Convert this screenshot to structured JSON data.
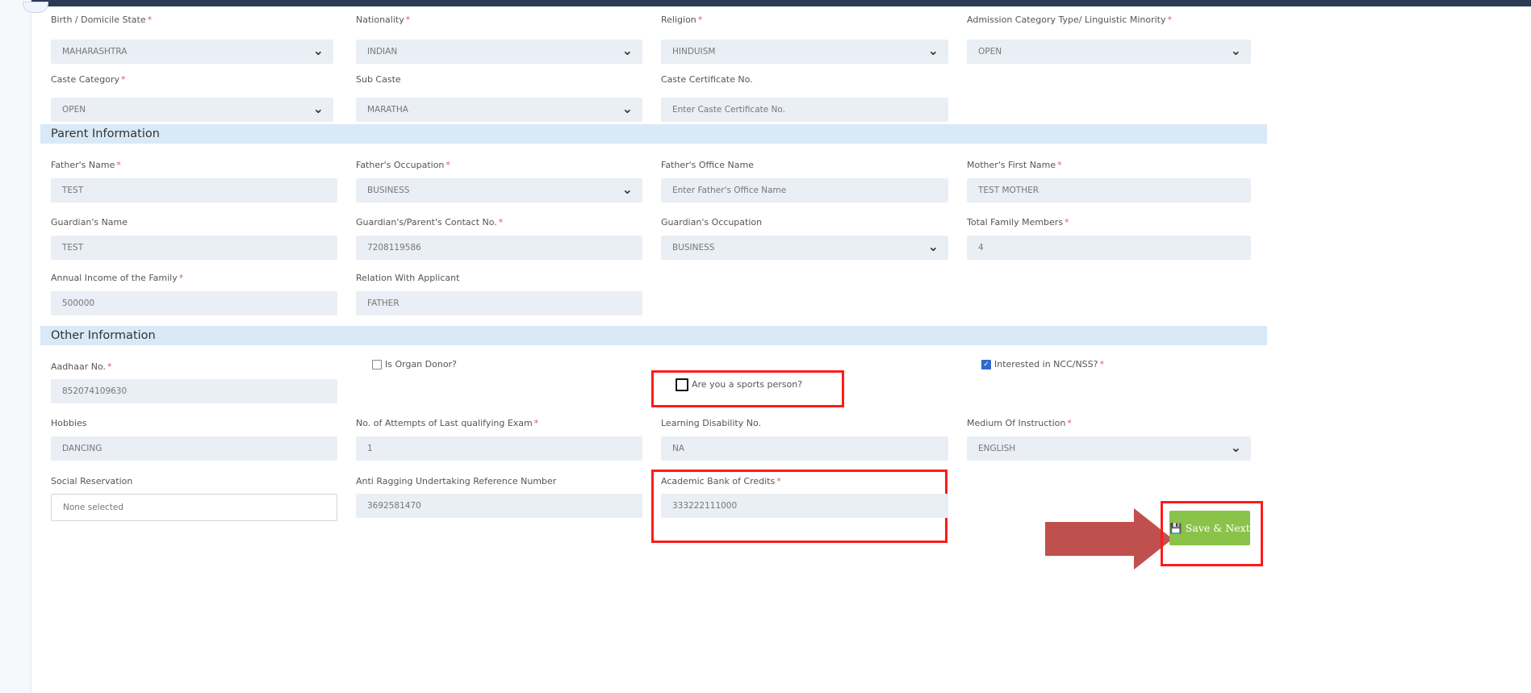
{
  "row1": [
    {
      "label": "Birth / Domicile State",
      "required": true,
      "value": "MAHARASHTRA"
    },
    {
      "label": "Nationality",
      "required": true,
      "value": "INDIAN"
    },
    {
      "label": "Religion",
      "required": true,
      "value": "HINDUISM"
    },
    {
      "label": "Admission Category Type/ Linguistic Minority",
      "required": true,
      "value": "OPEN"
    }
  ],
  "row2": [
    {
      "label": "Caste Category",
      "required": true,
      "value": "OPEN"
    },
    {
      "label": "Sub Caste",
      "required": false,
      "value": "MARATHA"
    },
    {
      "label": "Caste Certificate No.",
      "required": false,
      "placeholder": "Enter Caste Certificate No."
    }
  ],
  "parent": {
    "title": "Parent Information",
    "fathers_name": {
      "label": "Father's Name",
      "value": "TEST"
    },
    "fathers_occupation": {
      "label": "Father's Occupation",
      "value": "BUSINESS"
    },
    "fathers_office": {
      "label": "Father's Office Name",
      "placeholder": "Enter Father's Office Name"
    },
    "mothers_name": {
      "label": "Mother's First Name",
      "value": "TEST MOTHER"
    },
    "guardian_name": {
      "label": "Guardian's Name",
      "value": "TEST"
    },
    "guardian_contact": {
      "label": "Guardian's/Parent's Contact No.",
      "value": "7208119586"
    },
    "guardian_occupation": {
      "label": "Guardian's Occupation",
      "value": "BUSINESS"
    },
    "family_members": {
      "label": "Total Family Members",
      "value": "4"
    },
    "annual_income": {
      "label": "Annual Income of the Family",
      "value": "500000"
    },
    "relation": {
      "label": "Relation With Applicant",
      "value": "FATHER"
    }
  },
  "other": {
    "title": "Other Information",
    "aadhaar": {
      "label": "Aadhaar No.",
      "value": "852074109630"
    },
    "organ_donor": {
      "label": "Is Organ Donor?",
      "checked": false
    },
    "sports": {
      "label": "Are you a sports person?",
      "checked": false
    },
    "ncc": {
      "label": "Interested in NCC/NSS?",
      "checked": true
    },
    "hobbies": {
      "label": "Hobbies",
      "value": "DANCING"
    },
    "attempts": {
      "label": "No. of Attempts of Last qualifying Exam",
      "value": "1"
    },
    "disability": {
      "label": "Learning Disability No.",
      "value": "NA"
    },
    "medium": {
      "label": "Medium Of Instruction",
      "value": "ENGLISH"
    },
    "social": {
      "label": "Social Reservation",
      "value": "None selected"
    },
    "ragging": {
      "label": "Anti Ragging Undertaking Reference Number",
      "value": "3692581470"
    },
    "abc": {
      "label": "Academic Bank of Credits",
      "value": "333222111000"
    }
  },
  "required_mark": "*",
  "save_button": {
    "label": "Save & Next"
  },
  "icons": {
    "dropdown": "chevron-down-icon",
    "save": "floppy-disk-icon",
    "check": "checkmark-icon"
  },
  "colors": {
    "highlight": "#ff1a1a",
    "arrow": "#c0504d",
    "save_button": "#8bc34a",
    "section_bg": "#d9e9f7"
  }
}
